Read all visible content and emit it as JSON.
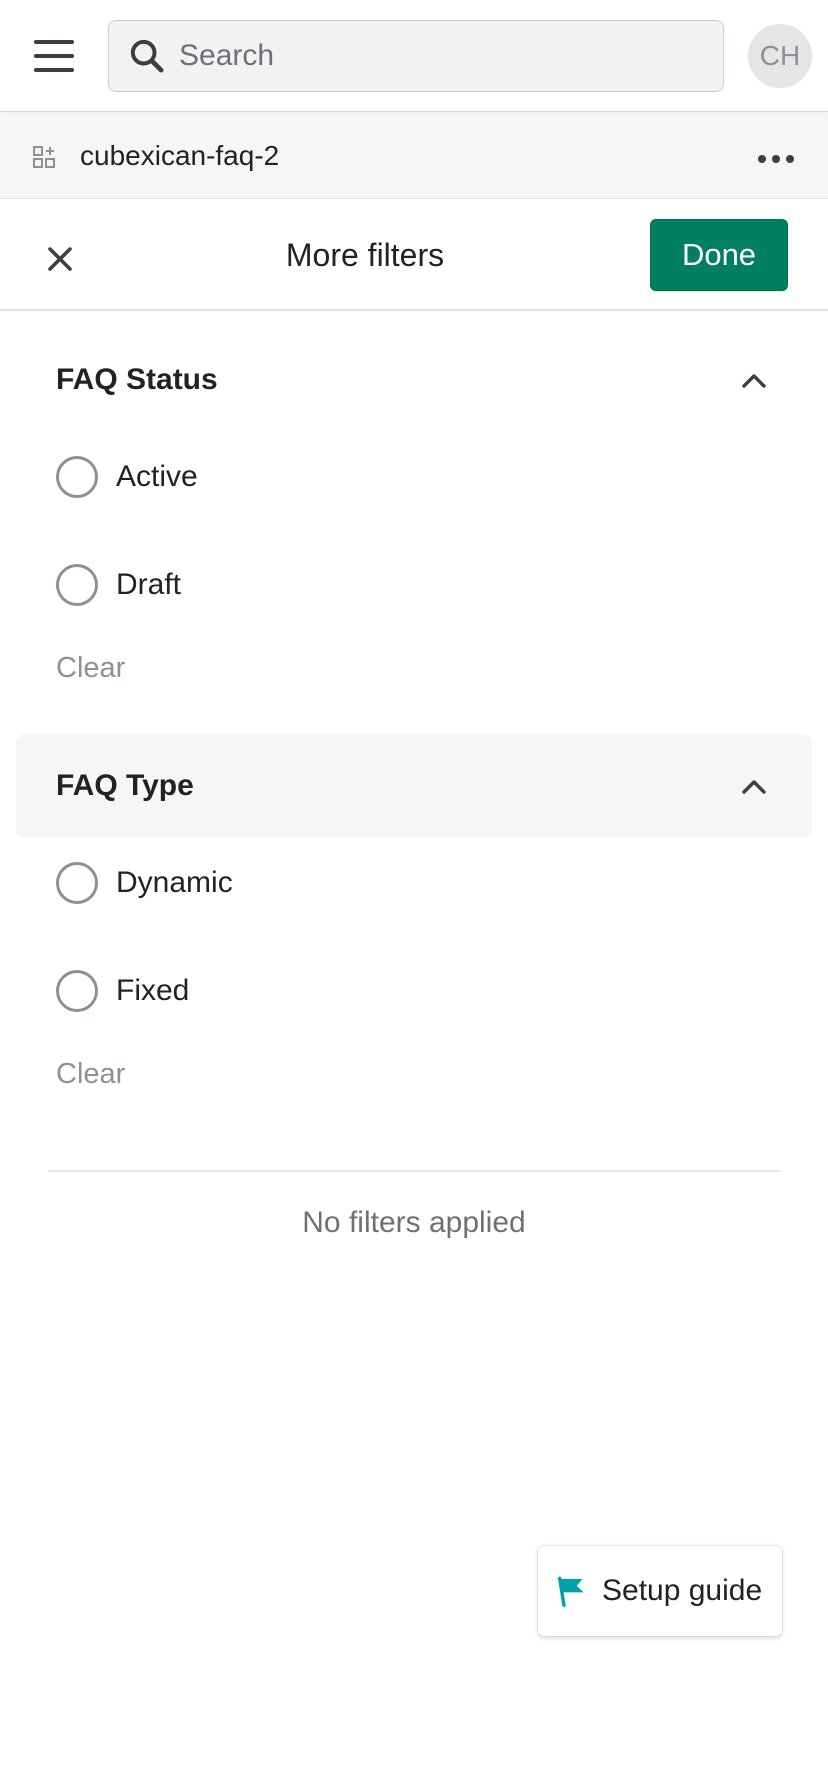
{
  "topbar": {
    "search_placeholder": "Search",
    "avatar_initials": "CH"
  },
  "appbar": {
    "app_name": "cubexican-faq-2"
  },
  "filter_header": {
    "title": "More filters",
    "done_label": "Done"
  },
  "sections": [
    {
      "title": "FAQ Status",
      "options": [
        "Active",
        "Draft"
      ],
      "clear_label": "Clear"
    },
    {
      "title": "FAQ Type",
      "options": [
        "Dynamic",
        "Fixed"
      ],
      "clear_label": "Clear"
    }
  ],
  "status_text": "No filters applied",
  "setup_guide": {
    "label": "Setup guide"
  },
  "colors": {
    "primary": "#008060",
    "flag": "#00a0ac"
  }
}
